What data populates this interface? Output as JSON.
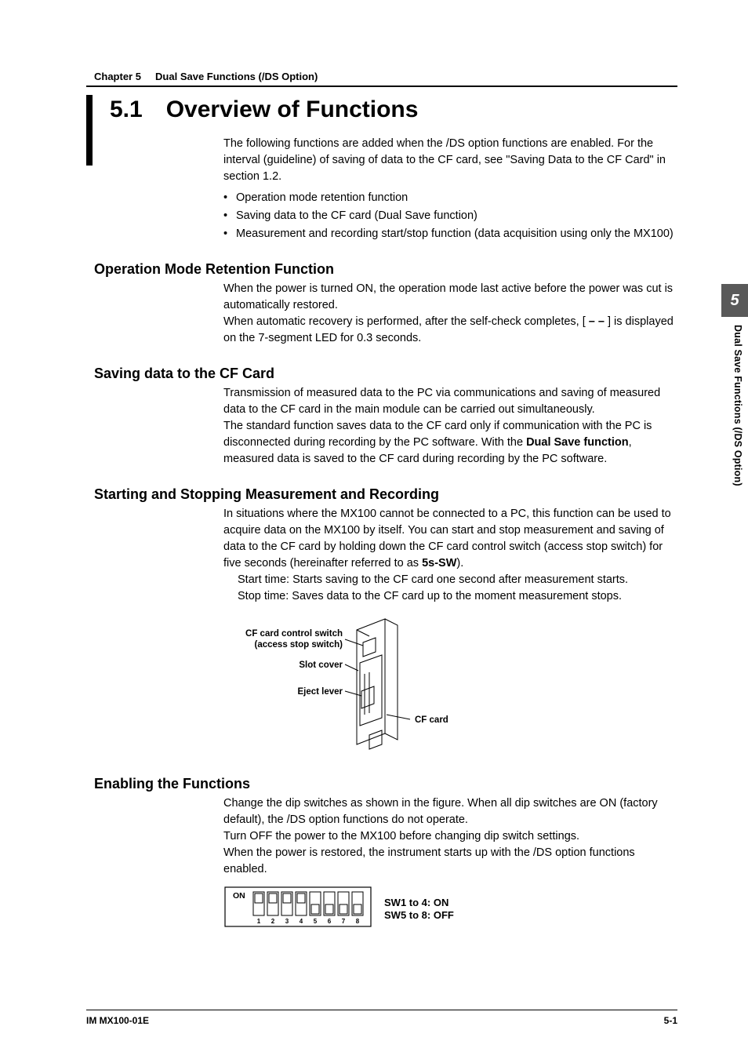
{
  "chapter": {
    "label": "Chapter 5",
    "title": "Dual Save Functions (/DS Option)"
  },
  "h1": {
    "num": "5.1",
    "title": "Overview of Functions"
  },
  "intro": {
    "p1": "The following functions are added when the /DS option functions are enabled. For the interval (guideline) of saving of data to the CF card, see \"Saving Data to the CF Card\" in section 1.2.",
    "b1": "Operation mode retention function",
    "b2": "Saving data to the CF card (Dual Save function)",
    "b3": "Measurement and recording start/stop function (data acquisition using only the MX100)"
  },
  "s1": {
    "h": "Operation Mode Retention Function",
    "p1": "When the power is turned ON, the operation mode last active before the power was cut is automatically restored.",
    "p2a": "When automatic recovery is performed, after the self-check completes, [",
    "p2b": " – – ",
    "p2c": "] is displayed on the 7-segment LED for 0.3 seconds."
  },
  "s2": {
    "h": "Saving data to the CF Card",
    "p1": "Transmission of measured data to the PC via communications and saving of measured data to the CF card in the main module can be carried out simultaneously.",
    "p2a": "The standard function saves data to the CF card only if communication with the PC is disconnected during recording by the PC software. With the ",
    "p2b": "Dual Save function",
    "p2c": ", measured data is saved to the CF card during recording by the PC software."
  },
  "s3": {
    "h": "Starting and Stopping Measurement and Recording",
    "p1a": "In situations where the MX100 cannot be connected to a PC, this function can be used to acquire data on the MX100 by itself. You can start and stop measurement and saving of data to the CF card by holding down the CF card control switch (access stop switch) for five seconds (hereinafter referred to as ",
    "p1b": "5s-SW",
    "p1c": ").",
    "l1": "Start time: Starts saving to the CF card one second after measurement starts.",
    "l2": "Stop time: Saves data to the CF card up to the moment measurement stops."
  },
  "fig1": {
    "lab1": "CF card control switch",
    "lab1b": "(access stop switch)",
    "lab2": "Slot cover",
    "lab3": "Eject lever",
    "lab4": "CF card"
  },
  "s4": {
    "h": "Enabling the Functions",
    "p1": "Change the dip switches as shown in the figure. When all dip switches are ON (factory default), the /DS option functions do not operate.",
    "p2": "Turn OFF the power to the MX100 before changing dip switch settings.",
    "p3": "When the power is restored, the instrument starts up with the /DS option functions enabled."
  },
  "fig2": {
    "on": "ON",
    "n1": "1",
    "n2": "2",
    "n3": "3",
    "n4": "4",
    "n5": "5",
    "n6": "6",
    "n7": "7",
    "n8": "8",
    "t1": "SW1 to 4: ON",
    "t2": "SW5 to 8: OFF"
  },
  "sidetab": {
    "num": "5",
    "text": "Dual Save Functions (/DS Option)"
  },
  "footer": {
    "left": "IM MX100-01E",
    "right": "5-1"
  }
}
